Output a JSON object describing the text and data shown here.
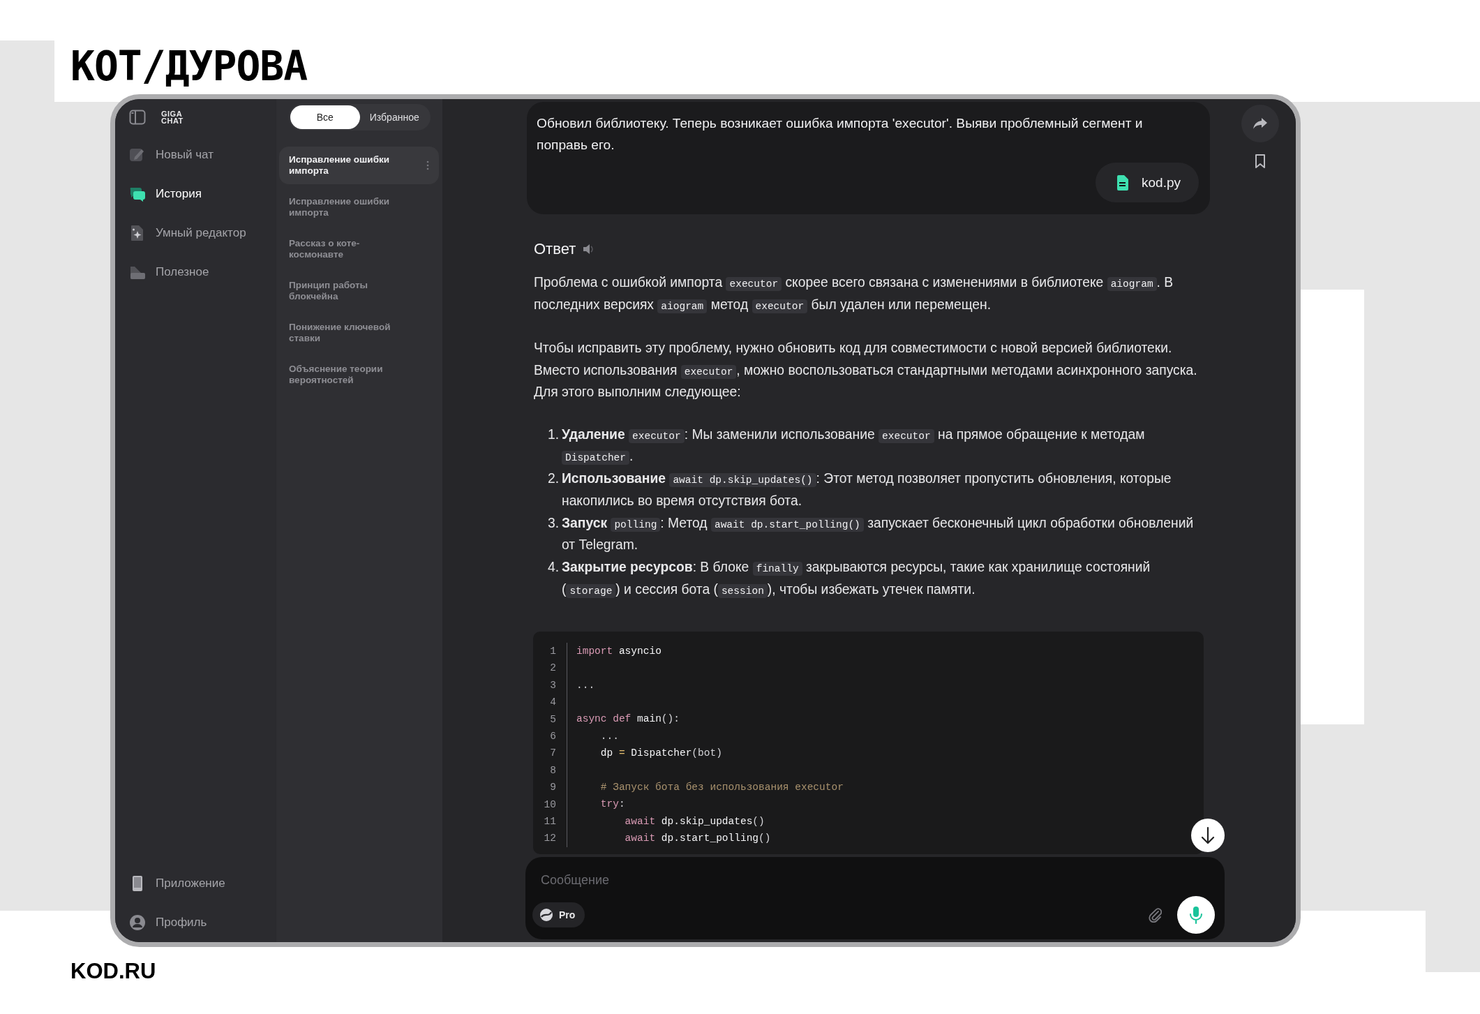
{
  "brand": {
    "logo": "КОТ/ДУРОВА",
    "footer": "KOD.RU"
  },
  "app": {
    "logo_lines": [
      "GIGA",
      "CHAT"
    ]
  },
  "sidebar": {
    "items": [
      {
        "label": "Новый чат",
        "selected": false
      },
      {
        "label": "История",
        "selected": true
      },
      {
        "label": "Умный редактор",
        "selected": false
      },
      {
        "label": "Полезное",
        "selected": false
      }
    ],
    "bottom_items": [
      {
        "label": "Приложение"
      },
      {
        "label": "Профиль"
      }
    ]
  },
  "history": {
    "tabs": [
      {
        "label": "Все",
        "selected": true
      },
      {
        "label": "Избранное",
        "selected": false
      }
    ],
    "items": [
      {
        "title": "Исправление ошибки импорта",
        "selected": true
      },
      {
        "title": "Исправление ошибки импорта",
        "selected": false
      },
      {
        "title": "Рассказ о коте-космонавте",
        "selected": false
      },
      {
        "title": "Принцип работы блокчейна",
        "selected": false
      },
      {
        "title": "Понижение ключевой ставки",
        "selected": false
      },
      {
        "title": "Объяснение теории вероятностей",
        "selected": false
      }
    ]
  },
  "chat": {
    "user_message": {
      "text": "Обновил библиотеку. Теперь возникает ошибка импорта 'executor'. Выяви проблемный сегмент и поправь его.",
      "attachment": "kod.py"
    },
    "answer": {
      "heading": "Ответ",
      "blocks": [
        {
          "kind": "paragraph",
          "segments": [
            {
              "kind": "text",
              "text": "Проблема с ошибкой импорта "
            },
            {
              "kind": "code",
              "text": "executor"
            },
            {
              "kind": "text",
              "text": " скорее всего связана с изменениями в библиотеке "
            },
            {
              "kind": "code",
              "text": "aiogram"
            },
            {
              "kind": "text",
              "text": ". В последних версиях "
            },
            {
              "kind": "code",
              "text": "aiogram"
            },
            {
              "kind": "text",
              "text": " метод "
            },
            {
              "kind": "code",
              "text": "executor"
            },
            {
              "kind": "text",
              "text": " был удален или перемещен."
            }
          ]
        },
        {
          "kind": "paragraph",
          "segments": [
            {
              "kind": "text",
              "text": "Чтобы исправить эту проблему, нужно обновить код для совместимости с новой версией библиотеки. Вместо использования "
            },
            {
              "kind": "code",
              "text": "executor"
            },
            {
              "kind": "text",
              "text": ", можно воспользоваться стандартными методами асинхронного запуска. Для этого выполним следующее:"
            }
          ]
        },
        {
          "kind": "list",
          "items": [
            {
              "number": "1.",
              "segments": [
                {
                  "kind": "bold",
                  "text": "Удаление "
                },
                {
                  "kind": "code",
                  "text": "executor"
                },
                {
                  "kind": "text",
                  "text": ": Мы заменили использование "
                },
                {
                  "kind": "code",
                  "text": "executor"
                },
                {
                  "kind": "text",
                  "text": " на прямое обращение к методам "
                },
                {
                  "kind": "code",
                  "text": "Dispatcher"
                },
                {
                  "kind": "text",
                  "text": "."
                }
              ]
            },
            {
              "number": "2.",
              "segments": [
                {
                  "kind": "bold",
                  "text": "Использование "
                },
                {
                  "kind": "code",
                  "text": "await dp.skip_updates()"
                },
                {
                  "kind": "text",
                  "text": ": Этот метод позволяет пропустить обновления, которые накопились во время отсутствия бота."
                }
              ]
            },
            {
              "number": "3.",
              "segments": [
                {
                  "kind": "bold",
                  "text": "Запуск "
                },
                {
                  "kind": "code",
                  "text": "polling"
                },
                {
                  "kind": "text",
                  "text": ": Метод "
                },
                {
                  "kind": "code",
                  "text": "await dp.start_polling()"
                },
                {
                  "kind": "text",
                  "text": " запускает бесконечный цикл обработки обновлений от Telegram."
                }
              ]
            },
            {
              "number": "4.",
              "segments": [
                {
                  "kind": "bold",
                  "text": "Закрытие ресурсов"
                },
                {
                  "kind": "text",
                  "text": ": В блоке "
                },
                {
                  "kind": "code",
                  "text": "finally"
                },
                {
                  "kind": "text",
                  "text": " закрываются ресурсы, такие как хранилище состояний ("
                },
                {
                  "kind": "code",
                  "text": "storage"
                },
                {
                  "kind": "text",
                  "text": ") и сессия бота ("
                },
                {
                  "kind": "code",
                  "text": "session"
                },
                {
                  "kind": "text",
                  "text": "), чтобы избежать утечек памяти."
                }
              ]
            }
          ]
        },
        {
          "kind": "code",
          "lines": [
            {
              "number": "1",
              "tokens": [
                {
                  "kind": "keyword",
                  "text": "import"
                },
                {
                  "kind": "name",
                  "text": " asyncio"
                }
              ]
            },
            {
              "number": "2"
            },
            {
              "number": "3",
              "tokens": [
                {
                  "kind": "plain",
                  "text": "..."
                }
              ]
            },
            {
              "number": "4"
            },
            {
              "number": "5",
              "tokens": [
                {
                  "kind": "keyword",
                  "text": "async def"
                },
                {
                  "kind": "name",
                  "text": " main"
                },
                {
                  "kind": "plain",
                  "text": "():"
                }
              ]
            },
            {
              "number": "6",
              "tokens": [
                {
                  "kind": "plain",
                  "text": "    ..."
                }
              ]
            },
            {
              "number": "7",
              "tokens": [
                {
                  "kind": "name",
                  "text": "    dp "
                },
                {
                  "kind": "operator",
                  "text": "="
                },
                {
                  "kind": "name",
                  "text": " Dispatcher"
                },
                {
                  "kind": "plain",
                  "text": "(bot)"
                }
              ]
            },
            {
              "number": "8"
            },
            {
              "number": "9",
              "tokens": [
                {
                  "kind": "comment",
                  "text": "    # Запуск бота без использования executor"
                }
              ]
            },
            {
              "number": "10",
              "tokens": [
                {
                  "kind": "keyword",
                  "text": "    try"
                },
                {
                  "kind": "plain",
                  "text": ":"
                }
              ]
            },
            {
              "number": "11",
              "tokens": [
                {
                  "kind": "keyword",
                  "text": "        await"
                },
                {
                  "kind": "name",
                  "text": " dp.skip_updates"
                },
                {
                  "kind": "plain",
                  "text": "()"
                }
              ]
            },
            {
              "number": "12",
              "tokens": [
                {
                  "kind": "keyword",
                  "text": "        await"
                },
                {
                  "kind": "name",
                  "text": " dp.start_polling"
                },
                {
                  "kind": "plain",
                  "text": "()"
                }
              ]
            }
          ]
        }
      ]
    }
  },
  "composer": {
    "placeholder": "Сообщение",
    "model": "Pro"
  }
}
